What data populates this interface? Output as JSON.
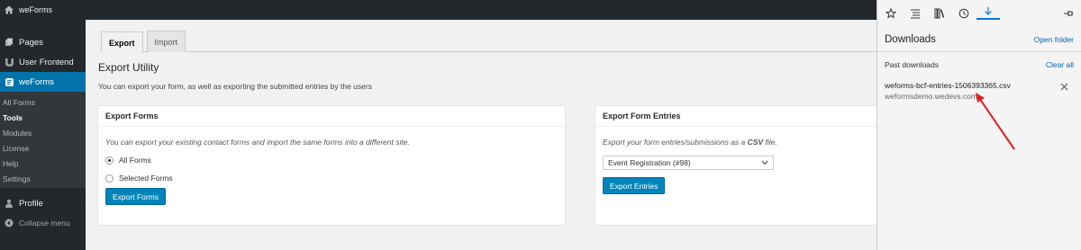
{
  "adminbar": {
    "site_name": "weForms"
  },
  "sidebar": {
    "items": [
      {
        "label": "Pages",
        "icon": "pages-icon"
      },
      {
        "label": "User Frontend",
        "icon": "user-frontend-icon"
      },
      {
        "label": "weForms",
        "icon": "weforms-icon"
      }
    ],
    "submenu": [
      "All Forms",
      "Tools",
      "Modules",
      "License",
      "Help",
      "Settings"
    ],
    "submenu_current": "Tools",
    "bottom": [
      {
        "label": "Profile",
        "icon": "profile-icon"
      },
      {
        "label": "Collapse menu",
        "icon": "collapse-icon"
      }
    ]
  },
  "main": {
    "tabs": [
      {
        "label": "Export"
      },
      {
        "label": "Import"
      }
    ],
    "title": "Export Utility",
    "description": "You can export your form, as well as exporting the submitted entries by the users",
    "export_forms": {
      "title": "Export Forms",
      "help": "You can export your existing contact forms and import the same forms into a different site.",
      "options": [
        "All Forms",
        "Selected Forms"
      ],
      "button": "Export Forms"
    },
    "export_entries": {
      "title": "Export Form Entries",
      "help_prefix": "Export your form entries/submissions as a ",
      "help_strong": "CSV",
      "help_suffix": " file.",
      "select_value": "Event Registration (#98)",
      "button": "Export Entries"
    }
  },
  "downloads": {
    "title": "Downloads",
    "open_folder": "Open folder",
    "past_label": "Past downloads",
    "clear_all": "Clear all",
    "items": [
      {
        "file": "weforms-bcf-entries-1506393365.csv",
        "source": "weformsdemo.wedevs.com"
      }
    ]
  },
  "colors": {
    "accent": "#0073aa",
    "annotation": "#e02020"
  }
}
